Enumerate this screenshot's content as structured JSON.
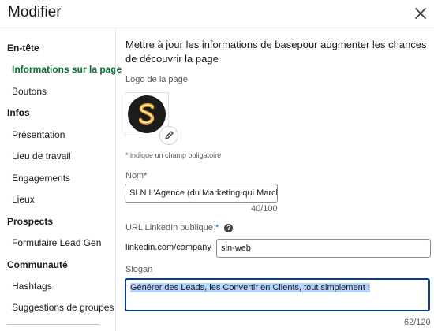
{
  "dialog": {
    "title": "Modifier",
    "close_icon": "close-icon"
  },
  "sidebar": {
    "sections": [
      {
        "title": "En-tête",
        "items": [
          "Informations sur la page",
          "Boutons"
        ]
      },
      {
        "title": "Infos",
        "items": [
          "Présentation",
          "Lieu de travail",
          "Engagements",
          "Lieux"
        ]
      },
      {
        "title": "Prospects",
        "items": [
          "Formulaire Lead Gen"
        ]
      },
      {
        "title": "Communauté",
        "items": [
          "Hashtags",
          "Suggestions de groupes"
        ]
      }
    ],
    "active_item": "Informations sur la page"
  },
  "main": {
    "intro": "Mettre à jour les informations de basepour augmenter les chances de découvrir la page",
    "logo_label": "Logo de la page",
    "required_note": "* indique un champ obligatoire",
    "name": {
      "label": "Nom*",
      "value": "SLN L'Agence (du Marketing qui Marche)",
      "counter": "40/100"
    },
    "url": {
      "label": "URL LinkedIn publique",
      "required_mark": "*",
      "help_icon": "?",
      "prefix": "linkedin.com/company",
      "value": "sln-web"
    },
    "slogan": {
      "label": "Slogan",
      "value": "Générer des Leads, les Convertir en Clients, tout simplement !",
      "counter": "62/120"
    }
  },
  "colors": {
    "active_nav": "#0b6b35",
    "focus_border": "#0a3d91",
    "logo_accent": "#f5a623",
    "selection": "#b3d4fc"
  }
}
